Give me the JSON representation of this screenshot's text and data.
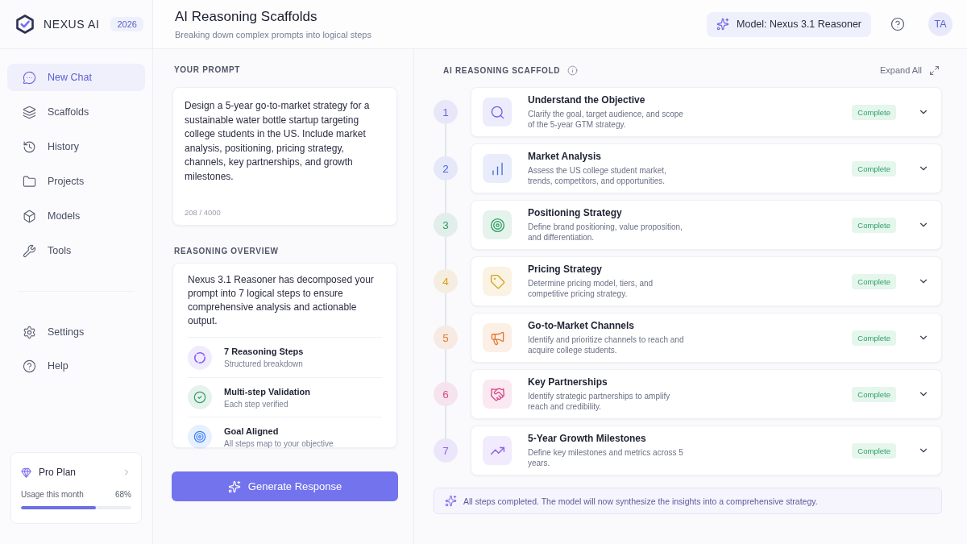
{
  "sidebar": {
    "brand": "NEXUS AI",
    "badge": "2026",
    "nav": [
      {
        "label": "New Chat",
        "selected": true
      },
      {
        "label": "Scaffolds",
        "selected": false
      },
      {
        "label": "History",
        "selected": false
      },
      {
        "label": "Projects",
        "selected": false
      },
      {
        "label": "Models",
        "selected": false
      },
      {
        "label": "Tools",
        "selected": false
      }
    ],
    "footer_nav": [
      {
        "label": "Settings",
        "selected": false
      },
      {
        "label": "Help",
        "selected": false
      }
    ],
    "plan": {
      "name": "Pro Plan",
      "usage_label": "Usage this month",
      "usage_reading": "68%",
      "level": 0.68
    }
  },
  "header": {
    "title": "AI Reasoning Scaffolds",
    "subtitle": "Breaking down complex prompts into logical steps",
    "model_button": "Model: Nexus 3.1 Reasoner",
    "avatar": "TA"
  },
  "prompt": {
    "heading": "YOUR PROMPT",
    "value": "Design a 5-year go-to-market strategy for a sustainable water bottle startup targeting college students in the US. Include market analysis, positioning, pricing strategy, channels, key partnerships, and growth milestones.",
    "counter": "208 / 4000"
  },
  "overview": {
    "heading": "REASONING OVERVIEW",
    "summary": "Nexus 3.1 Reasoner has decomposed your prompt into 7 logical steps to ensure comprehensive analysis and actionable output.",
    "items": [
      {
        "title": "7 Reasoning Steps",
        "subtitle": "Structured breakdown",
        "color": "#8b5cf6"
      },
      {
        "title": "Multi-step Validation",
        "subtitle": "Each step verified",
        "color": "#2e9e66"
      },
      {
        "title": "Goal Aligned",
        "subtitle": "All steps map to your objective",
        "color": "#3b82f6"
      }
    ]
  },
  "generate_button": "Generate Response",
  "scaffold": {
    "heading": "AI REASONING SCAFFOLD",
    "expand_all": "Expand All",
    "steps": [
      {
        "number": "1",
        "title": "Understand the Objective",
        "description": "Clarify the goal, target audience, and scope of the 5-year GTM strategy.",
        "status": "Complete",
        "color": "#6c63e6",
        "expanded": false
      },
      {
        "number": "2",
        "title": "Market Analysis",
        "description": "Assess the US college student market, trends, competitors, and opportunities.",
        "status": "Complete",
        "color": "#4a67e0",
        "expanded": false
      },
      {
        "number": "3",
        "title": "Positioning Strategy",
        "description": "Define brand positioning, value proposition, and differentiation.",
        "status": "Complete",
        "color": "#2e9e66",
        "expanded": false
      },
      {
        "number": "4",
        "title": "Pricing Strategy",
        "description": "Determine pricing model, tiers, and competitive pricing strategy.",
        "status": "Complete",
        "color": "#d4a017",
        "expanded": false
      },
      {
        "number": "5",
        "title": "Go-to-Market Channels",
        "description": "Identify and prioritize channels to reach and acquire college students.",
        "status": "Complete",
        "color": "#e07a35",
        "expanded": false
      },
      {
        "number": "6",
        "title": "Key Partnerships",
        "description": "Identify strategic partnerships to amplify reach and credibility.",
        "status": "Complete",
        "color": "#d64a8c",
        "expanded": false
      },
      {
        "number": "7",
        "title": "5-Year Growth Milestones",
        "description": "Define key milestones and metrics across 5 years.",
        "status": "Complete",
        "color": "#8b5cf0",
        "expanded": false
      }
    ],
    "note": "All steps completed. The model will now synthesize the insights into a comprehensive strategy."
  }
}
